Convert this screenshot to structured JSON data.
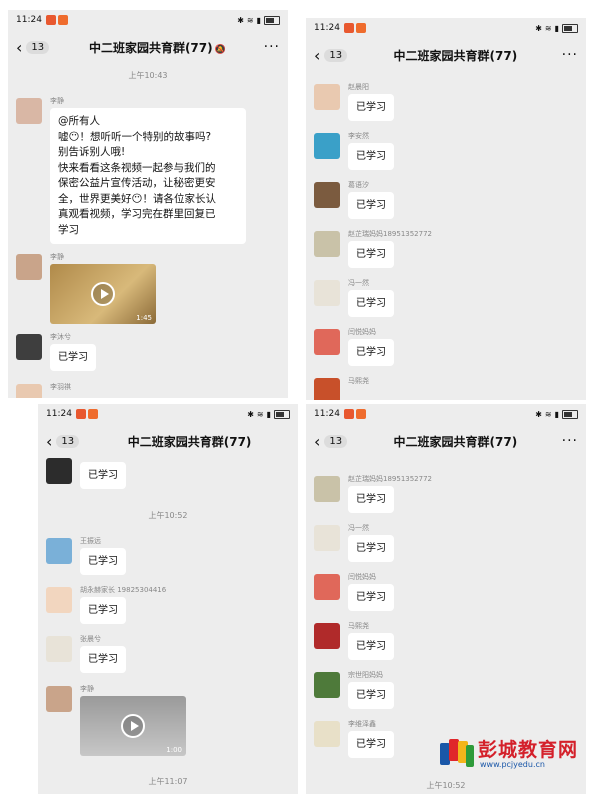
{
  "status_time": "11:24",
  "group_title": "中二班家园共育群(77)",
  "unread_count": "13",
  "reply_text": "已学习",
  "panel1": {
    "time_1": "上午10:43",
    "msg1_sender": "李静",
    "msg1_lines": [
      "@所有人",
      "嘘😶！想听听一个特别的故事吗?",
      "别告诉别人哦!",
      "快来看看这条视频一起参与我们的",
      "保密公益片宣传活动，让秘密更安",
      "全，世界更美好😶！请各位家长认",
      "真观看视频，学习完在群里回复已",
      "学习"
    ],
    "msg2_sender": "李静",
    "video1_duration": "1:45",
    "msg3_sender": "李沐兮",
    "msg4_sender": "李羽祺"
  },
  "panel2": {
    "senders": [
      "赵晨阳",
      "李安然",
      "葛语汐",
      "赵芷瑞妈妈18951352772",
      "冯一然",
      "闫悦妈妈",
      "马熙尧"
    ]
  },
  "panel3": {
    "time_1": "上午10:52",
    "senders": [
      "王振远",
      "胡永赫家长 19825304416",
      "张晨兮"
    ],
    "video_sender": "李静",
    "video2_duration": "1:00",
    "time_2": "上午11:07"
  },
  "panel4": {
    "senders": [
      "赵芷瑞妈妈18951352772",
      "冯一然",
      "闫悦妈妈",
      "马熙尧",
      "宗世阳妈妈",
      "李维泽鑫"
    ],
    "time_1": "上午10:52"
  },
  "watermark": {
    "name": "彭城教育网",
    "url": "www.pcjyedu.cn"
  }
}
